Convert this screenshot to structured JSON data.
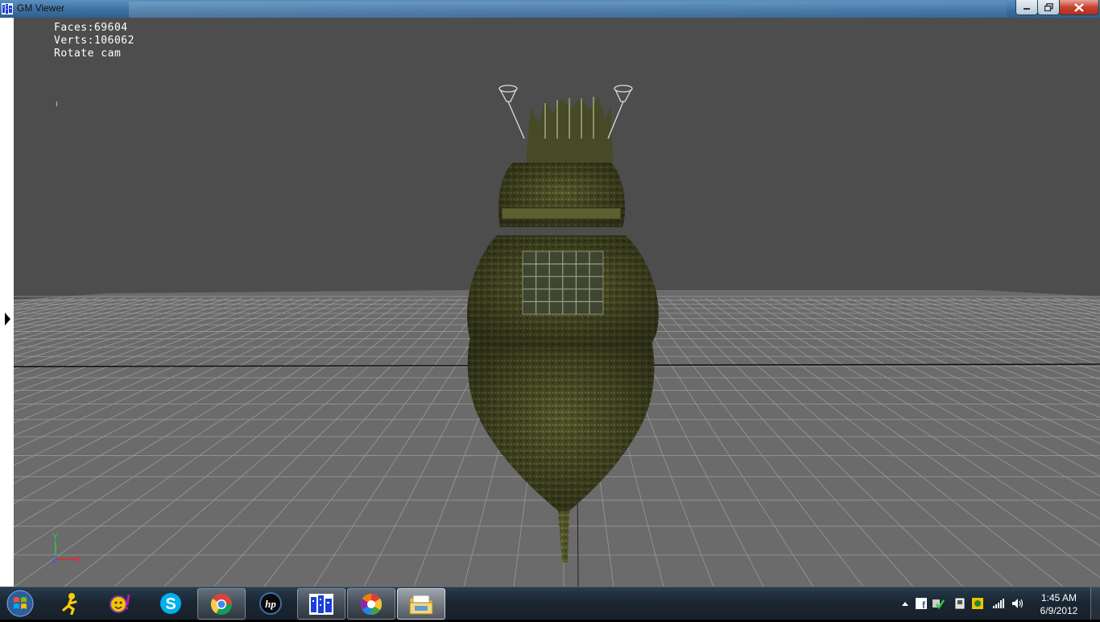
{
  "window": {
    "title": "GM Viewer",
    "buttons": [
      "minimize",
      "maximize",
      "close"
    ]
  },
  "viewport": {
    "stats": {
      "faces": "Faces:69604",
      "verts": "Verts:106062",
      "mode": "Rotate cam"
    },
    "background_color": "#4d4d4d",
    "floor_color": "#6b6b6b",
    "grid_color": "#9a9a9a",
    "model": "ship-stern"
  },
  "axes": {
    "y": "Y",
    "z": "Z",
    "x": "X"
  },
  "taskbar": {
    "items": [
      {
        "name": "aim-icon",
        "state": "pinned"
      },
      {
        "name": "yahoo-messenger-icon",
        "state": "pinned"
      },
      {
        "name": "skype-icon",
        "state": "pinned"
      },
      {
        "name": "chrome-icon",
        "state": "open"
      },
      {
        "name": "hp-icon",
        "state": "pinned"
      },
      {
        "name": "gm-viewer-icon",
        "state": "open"
      },
      {
        "name": "picasa-icon",
        "state": "open"
      },
      {
        "name": "file-explorer-icon",
        "state": "active"
      }
    ],
    "tray": [
      "show-hidden-icon",
      "facebook-icon",
      "sync-icon",
      "device-icon",
      "security-icon",
      "network-icon",
      "volume-icon"
    ],
    "time": "1:45 AM",
    "date": "6/9/2012"
  }
}
